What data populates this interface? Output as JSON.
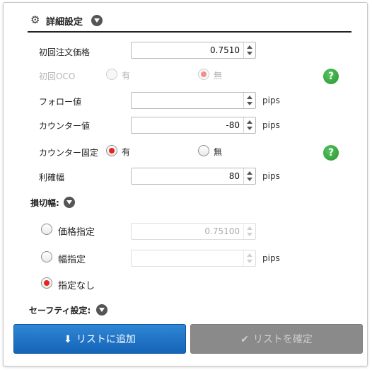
{
  "header": {
    "title": "詳細設定"
  },
  "fields": {
    "initial_price": {
      "label": "初回注文価格",
      "value": "0.7510"
    },
    "initial_oco": {
      "label": "初回OCO",
      "option_yes": "有",
      "option_no": "無"
    },
    "follow": {
      "label": "フォロー値",
      "value": "",
      "unit": "pips"
    },
    "counter": {
      "label": "カウンター値",
      "value": "-80",
      "unit": "pips"
    },
    "counter_fixed": {
      "label": "カウンター固定",
      "option_yes": "有",
      "option_no": "無"
    },
    "take_profit": {
      "label": "利確幅",
      "value": "80",
      "unit": "pips"
    }
  },
  "stop_loss": {
    "title": "損切幅:",
    "price_option": {
      "label": "価格指定",
      "value": "0.75100"
    },
    "width_option": {
      "label": "幅指定",
      "value": "",
      "unit": "pips"
    },
    "none_option": {
      "label": "指定なし"
    }
  },
  "safety": {
    "title": "セーフティ設定:"
  },
  "buttons": {
    "add_to_list": "リストに追加",
    "confirm_list": "リストを確定"
  },
  "icons": {
    "help": "?",
    "colors": {
      "primary": "#1a6fc4",
      "help": "#3aa63f",
      "radio_on": "#e8231f"
    }
  }
}
